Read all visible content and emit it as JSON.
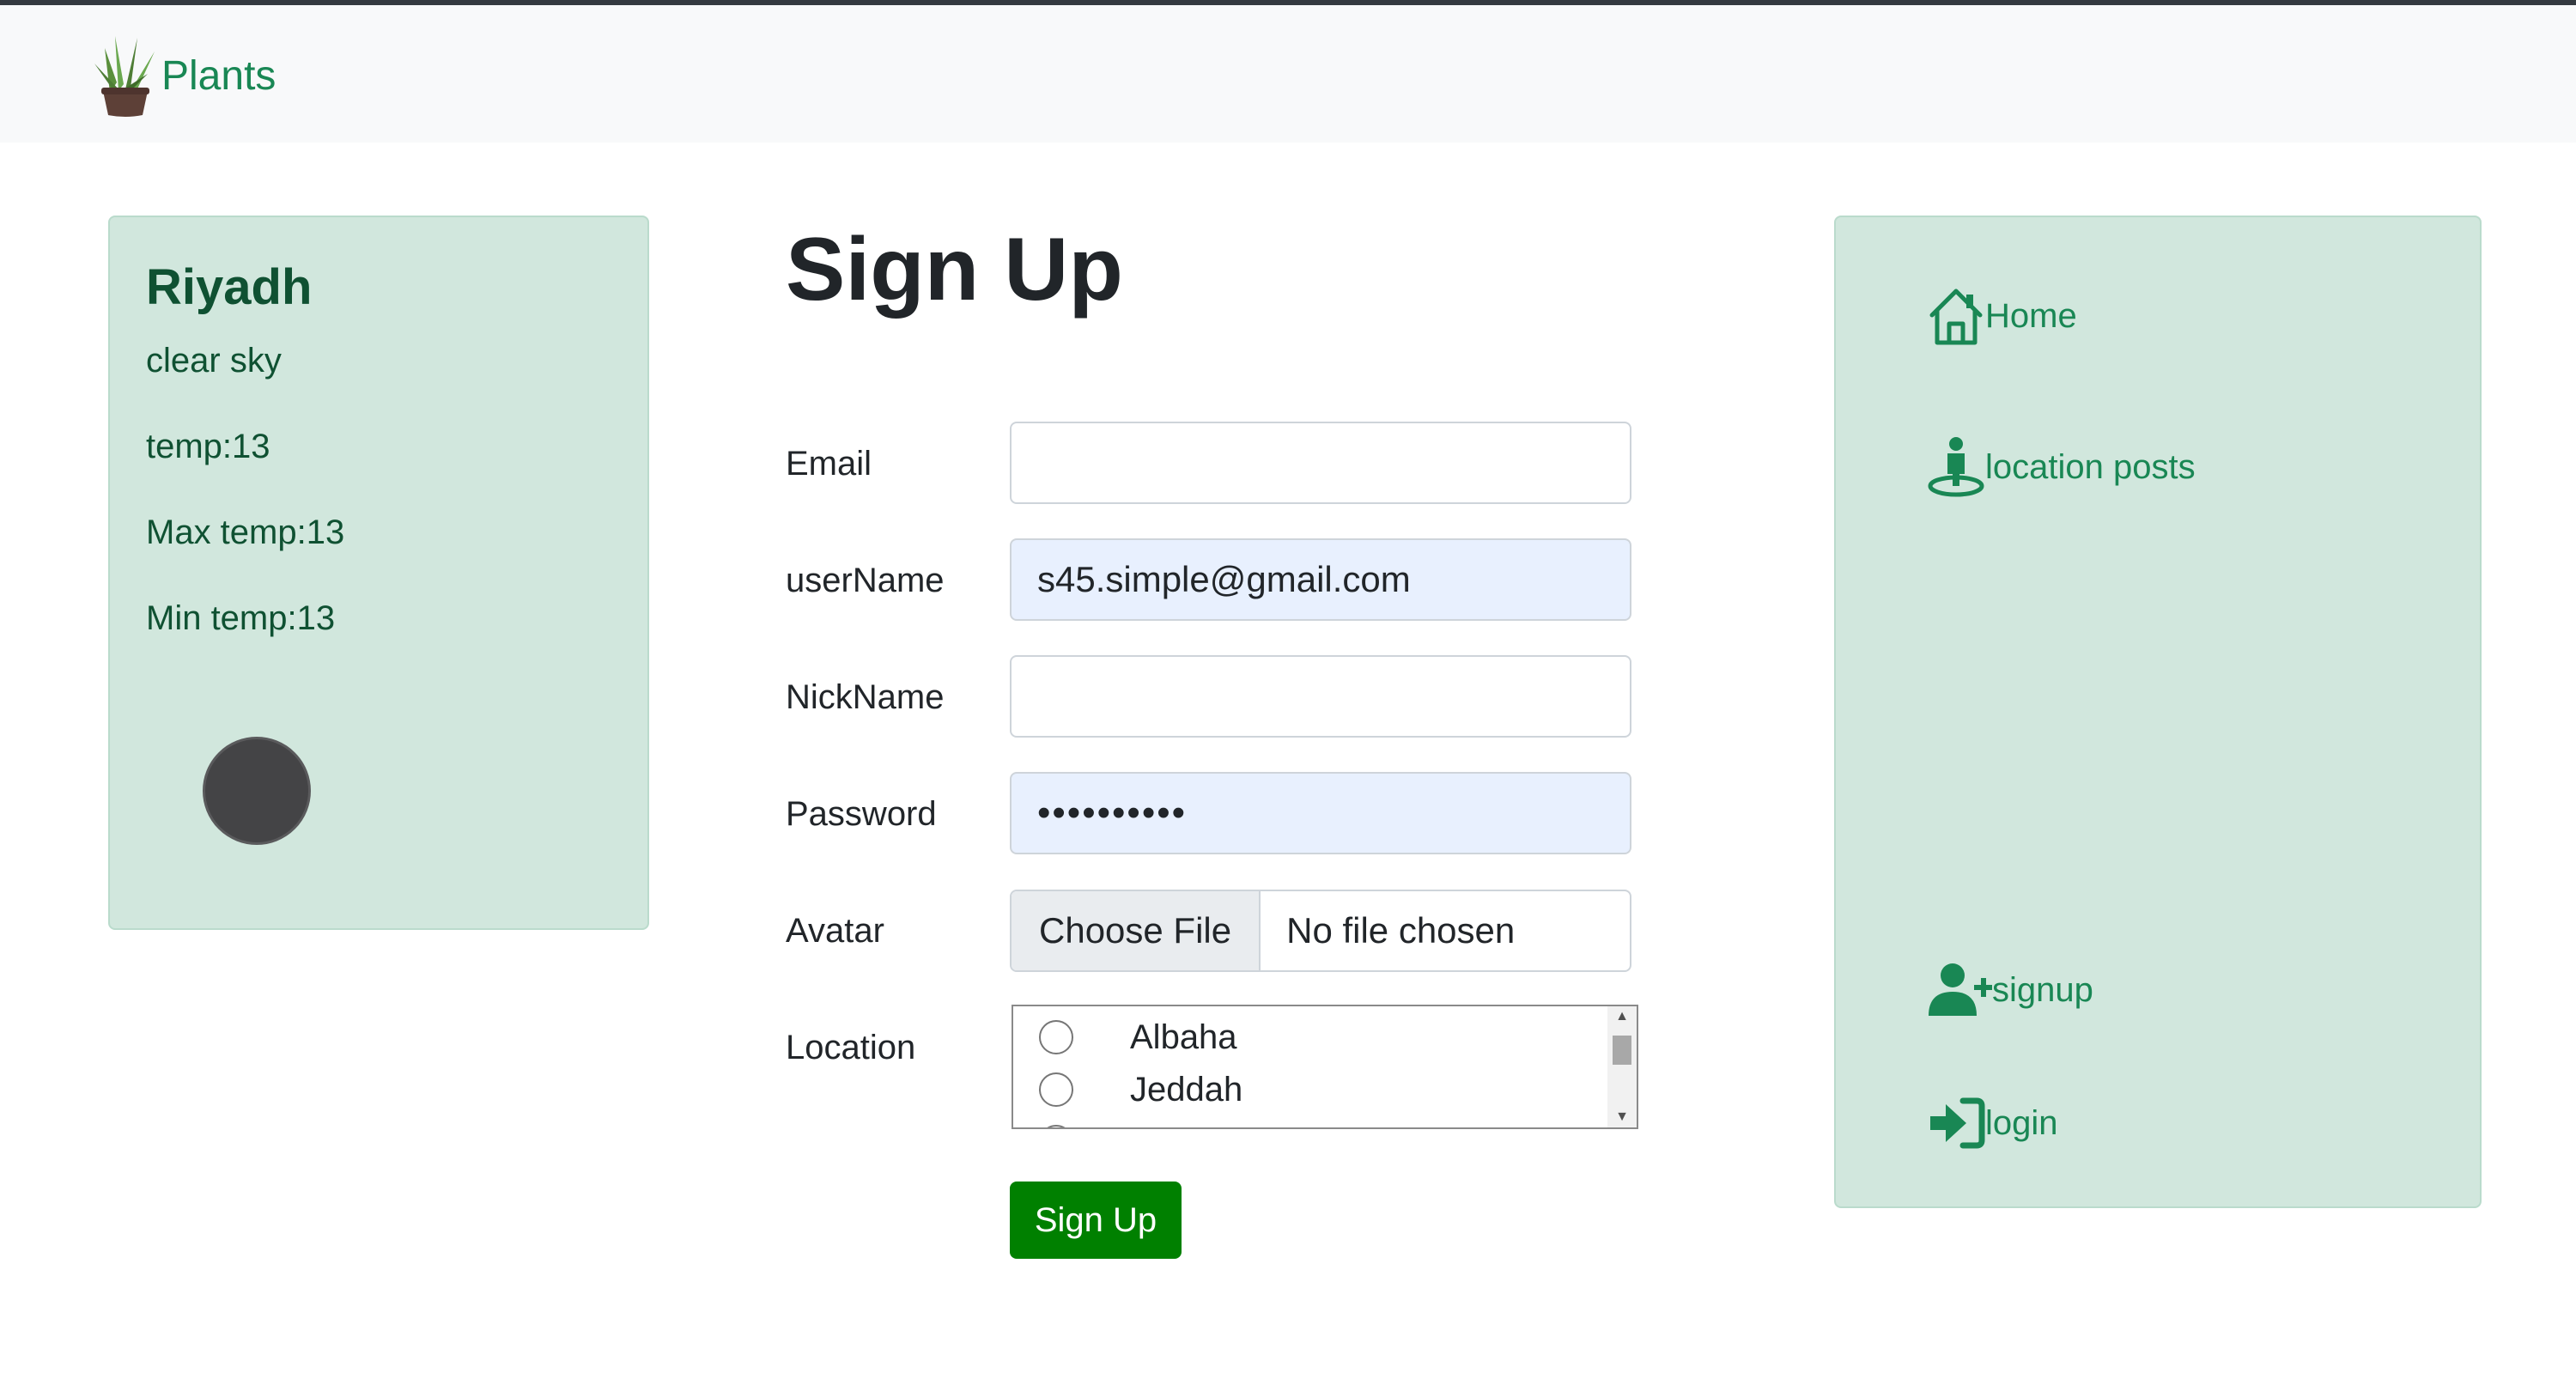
{
  "brand": {
    "name": "Plants",
    "icon": "plant-pot-icon"
  },
  "weather": {
    "city": "Riyadh",
    "description": "clear sky",
    "temp": "temp:13",
    "max_temp": "Max temp:13",
    "min_temp": "Min temp:13",
    "icon": "weather-icon"
  },
  "form": {
    "title": "Sign Up",
    "email_label": "Email",
    "email_value": "",
    "username_label": "userName",
    "username_value": "s45.simple@gmail.com",
    "nickname_label": "NickName",
    "nickname_value": "",
    "password_label": "Password",
    "password_value": "••••••••••",
    "avatar_label": "Avatar",
    "file_button": "Choose File",
    "file_status": "No file chosen",
    "location_label": "Location",
    "locations": [
      "Albaha",
      "Jeddah"
    ],
    "submit_label": "Sign Up"
  },
  "sidebar": {
    "items": [
      {
        "label": "Home",
        "icon": "home-icon"
      },
      {
        "label": "location posts",
        "icon": "person-location-icon"
      },
      {
        "label": "signup",
        "icon": "person-plus-icon"
      },
      {
        "label": "login",
        "icon": "login-arrow-icon"
      }
    ]
  },
  "colors": {
    "brand_green": "#198754",
    "panel_bg": "#d1e7dd",
    "panel_text": "#0f5132",
    "button_green": "#008000",
    "autofill_bg": "#e8f0fe",
    "navbar_bg": "#f8f9fa"
  }
}
